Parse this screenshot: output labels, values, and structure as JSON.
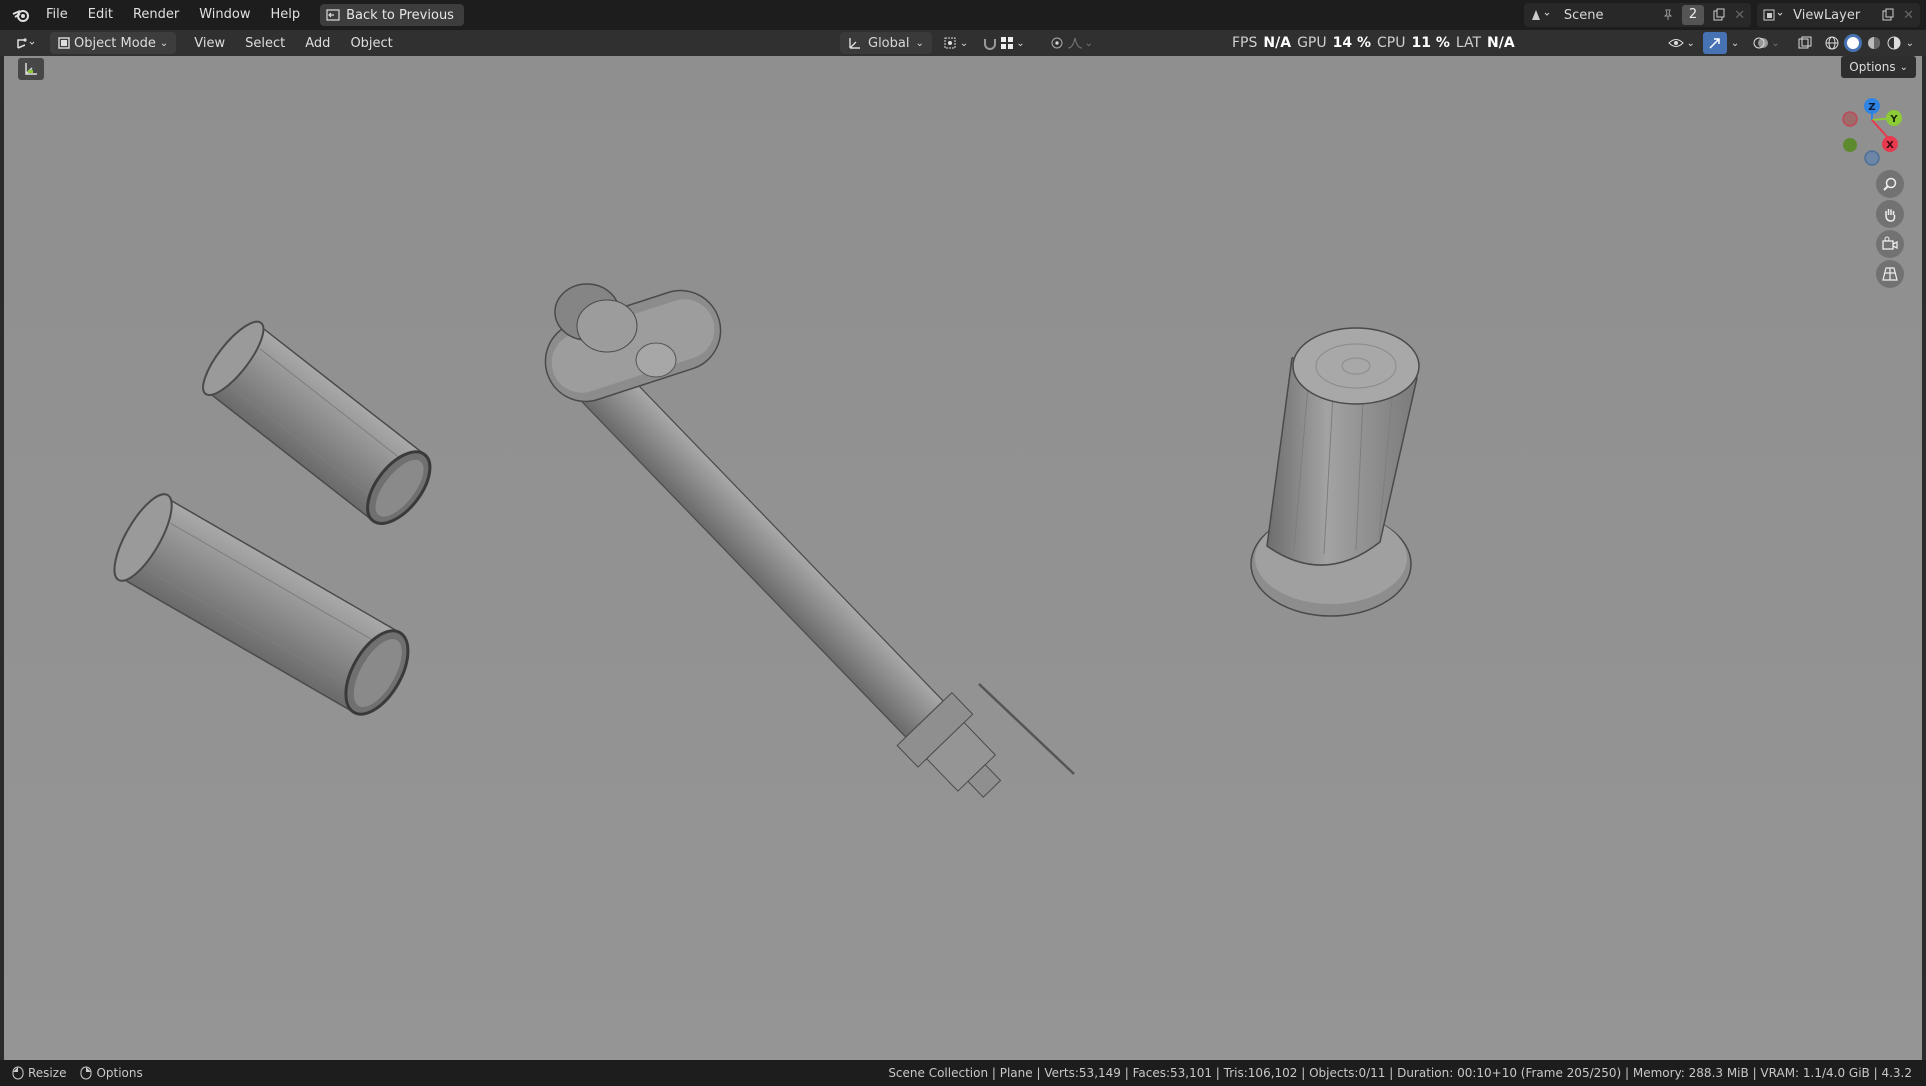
{
  "menu": {
    "items": [
      "File",
      "Edit",
      "Render",
      "Window",
      "Help"
    ],
    "back_button": "Back to Previous"
  },
  "workspace": {
    "scene_name": "Scene",
    "scene_count": "2",
    "view_layer": "ViewLayer"
  },
  "header": {
    "mode": "Object Mode",
    "menus": [
      "View",
      "Select",
      "Add",
      "Object"
    ],
    "transform_orientation": "Global",
    "stats": {
      "fps_label": "FPS",
      "fps_value": "N/A",
      "gpu_label": "GPU",
      "gpu_value": "14 %",
      "cpu_label": "CPU",
      "cpu_value": "11 %",
      "lat_label": "LAT",
      "lat_value": "N/A"
    }
  },
  "viewport": {
    "options_label": "Options",
    "gizmo_axes": [
      "Z",
      "Y",
      "X"
    ],
    "axis_colors": {
      "x": "#e8394f",
      "y": "#8ccb37",
      "z": "#2f84e3"
    }
  },
  "statusbar": {
    "resize_label": "Resize",
    "options_label": "Options",
    "info": "Scene Collection | Plane | Verts:53,149 | Faces:53,101 | Tris:106,102 | Objects:0/11 | Duration: 00:10+10 (Frame 205/250) | Memory: 288.3 MiB | VRAM: 1.1/4.0 GiB | 4.3.2"
  }
}
